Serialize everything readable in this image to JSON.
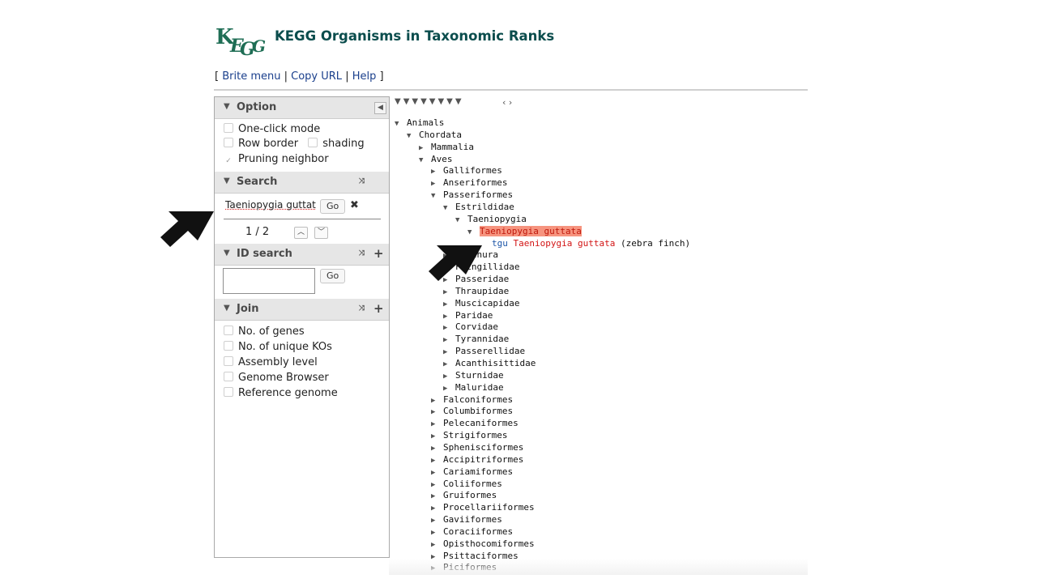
{
  "header": {
    "logo_text": "KEGG",
    "title": "KEGG Organisms in Taxonomic Ranks",
    "nav": {
      "open": "[",
      "brite_menu": "Brite menu",
      "sep1": "|",
      "copy_url": "Copy URL",
      "sep2": "|",
      "help": "Help",
      "close": "]"
    }
  },
  "sidebar": {
    "option": {
      "title": "Option",
      "items": [
        {
          "label": "One-click mode",
          "checked": false
        },
        {
          "label": "Row border",
          "checked": false
        },
        {
          "label": "shading",
          "checked": false
        },
        {
          "label": "Pruning neighbor",
          "checked": true
        }
      ]
    },
    "search": {
      "title": "Search",
      "value": "Taeniopygia guttat",
      "go_label": "Go",
      "clear_glyph": "✖",
      "result_count": "1 / 2"
    },
    "id_search": {
      "title": "ID search",
      "value": "",
      "go_label": "Go"
    },
    "join": {
      "title": "Join",
      "items": [
        {
          "label": "No. of genes",
          "checked": false
        },
        {
          "label": "No. of unique KOs",
          "checked": false
        },
        {
          "label": "Assembly level",
          "checked": false
        },
        {
          "label": "Genome Browser",
          "checked": false
        },
        {
          "label": "Reference genome",
          "checked": false
        }
      ]
    }
  },
  "tree": {
    "level_controls": "▼▼▼▼▼▼▼▼",
    "scroll_controls": "‹ ›",
    "nodes": [
      {
        "label": "Animals",
        "state": "expanded",
        "depth": 0
      },
      {
        "label": "Chordata",
        "state": "expanded",
        "depth": 1
      },
      {
        "label": "Mammalia",
        "state": "collapsed",
        "depth": 2
      },
      {
        "label": "Aves",
        "state": "expanded",
        "depth": 2
      },
      {
        "label": "Galliformes",
        "state": "collapsed",
        "depth": 3
      },
      {
        "label": "Anseriformes",
        "state": "collapsed",
        "depth": 3
      },
      {
        "label": "Passeriformes",
        "state": "expanded",
        "depth": 3
      },
      {
        "label": "Estrildidae",
        "state": "expanded",
        "depth": 4
      },
      {
        "label": "Taeniopygia",
        "state": "expanded",
        "depth": 5
      },
      {
        "label": "Taeniopygia guttata",
        "state": "expanded",
        "depth": 6,
        "highlight": true
      },
      {
        "code": "tgu",
        "label": "Taeniopygia guttata",
        "common": "(zebra finch)",
        "state": "leaf",
        "depth": 7
      },
      {
        "label": "Lonchura",
        "state": "collapsed",
        "depth": 4
      },
      {
        "label": "Fringillidae",
        "state": "collapsed",
        "depth": 4
      },
      {
        "label": "Passeridae",
        "state": "collapsed",
        "depth": 4
      },
      {
        "label": "Thraupidae",
        "state": "collapsed",
        "depth": 4
      },
      {
        "label": "Muscicapidae",
        "state": "collapsed",
        "depth": 4
      },
      {
        "label": "Paridae",
        "state": "collapsed",
        "depth": 4
      },
      {
        "label": "Corvidae",
        "state": "collapsed",
        "depth": 4
      },
      {
        "label": "Tyrannidae",
        "state": "collapsed",
        "depth": 4
      },
      {
        "label": "Passerellidae",
        "state": "collapsed",
        "depth": 4
      },
      {
        "label": "Acanthisittidae",
        "state": "collapsed",
        "depth": 4
      },
      {
        "label": "Sturnidae",
        "state": "collapsed",
        "depth": 4
      },
      {
        "label": "Maluridae",
        "state": "collapsed",
        "depth": 4
      },
      {
        "label": "Falconiformes",
        "state": "collapsed",
        "depth": 3
      },
      {
        "label": "Columbiformes",
        "state": "collapsed",
        "depth": 3
      },
      {
        "label": "Pelecaniformes",
        "state": "collapsed",
        "depth": 3
      },
      {
        "label": "Strigiformes",
        "state": "collapsed",
        "depth": 3
      },
      {
        "label": "Sphenisciformes",
        "state": "collapsed",
        "depth": 3
      },
      {
        "label": "Accipitriformes",
        "state": "collapsed",
        "depth": 3
      },
      {
        "label": "Cariamiformes",
        "state": "collapsed",
        "depth": 3
      },
      {
        "label": "Coliiformes",
        "state": "collapsed",
        "depth": 3
      },
      {
        "label": "Gruiformes",
        "state": "collapsed",
        "depth": 3
      },
      {
        "label": "Procellariiformes",
        "state": "collapsed",
        "depth": 3
      },
      {
        "label": "Gaviiformes",
        "state": "collapsed",
        "depth": 3
      },
      {
        "label": "Coraciiformes",
        "state": "collapsed",
        "depth": 3
      },
      {
        "label": "Opisthocomiformes",
        "state": "collapsed",
        "depth": 3
      },
      {
        "label": "Psittaciformes",
        "state": "collapsed",
        "depth": 3
      },
      {
        "label": "Piciformes",
        "state": "collapsed",
        "depth": 3
      }
    ]
  },
  "colors": {
    "title": "#0b4d4d",
    "link": "#1a3f8c",
    "highlight_bg": "#f6947f",
    "highlight_text": "#c0180b",
    "organism_code": "#1d56a8",
    "organism_name": "#d21414"
  }
}
